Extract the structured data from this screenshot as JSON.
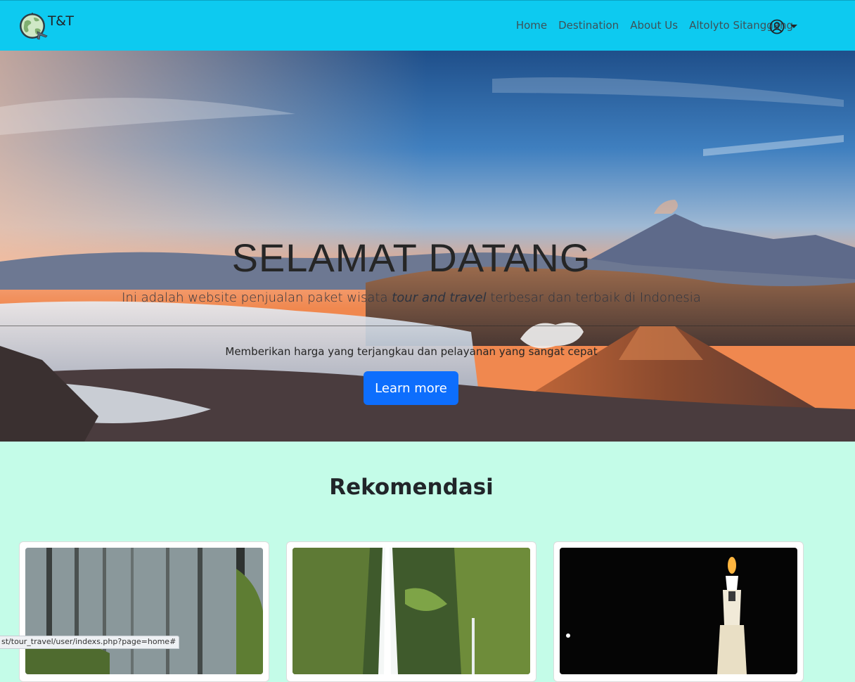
{
  "brand": {
    "name": "T&T",
    "logo_icon": "globe-airplane-logo"
  },
  "nav": {
    "items": [
      {
        "label": "Home"
      },
      {
        "label": "Destination"
      },
      {
        "label": "About Us"
      },
      {
        "label": "Altolyto Sitanggang"
      }
    ],
    "user_icon": "user-circle-icon"
  },
  "hero": {
    "title": "SELAMAT DATANG",
    "lead_before": "Ini adalah website penjualan paket wisata ",
    "lead_emphasis": "tour and travel",
    "lead_after": " terbesar dan terbaik di Indonesia",
    "subtext": "Memberikan harga yang terjangkau dan pelayanan yang sangat cepat",
    "cta_label": "Learn more"
  },
  "recommendations": {
    "title": "Rekomendasi",
    "cards": [
      {
        "image": "pine-forest-photo"
      },
      {
        "image": "waterfall-photo"
      },
      {
        "image": "night-monument-tugu-photo"
      }
    ]
  },
  "status_bar": {
    "url": "st/tour_travel/user/indexs.php?page=home#"
  },
  "colors": {
    "navbar": "#0dcaf0",
    "background": "#c4fce8",
    "primary": "#0d6efd"
  }
}
